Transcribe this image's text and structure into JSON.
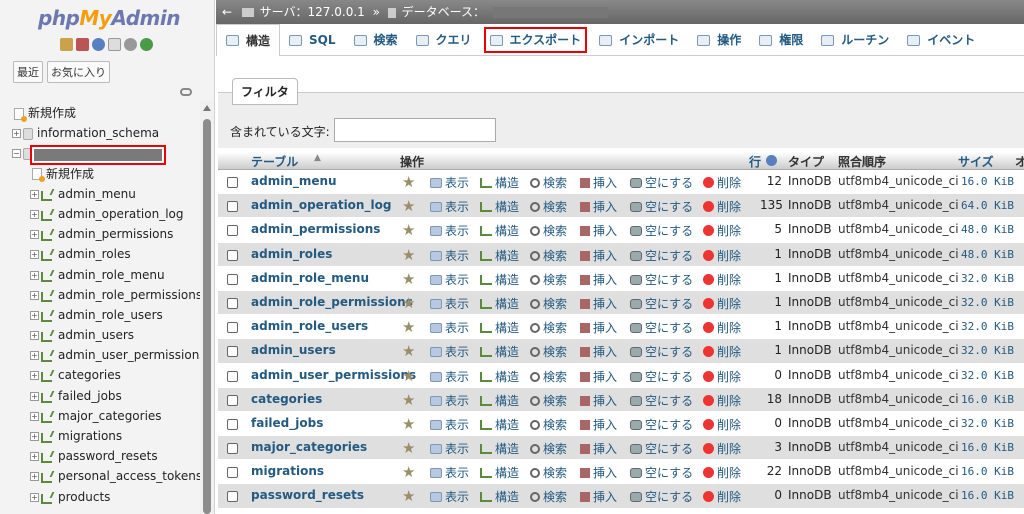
{
  "nav": {
    "logo": {
      "php": "php",
      "my": "My",
      "admin": "Admin"
    },
    "recent": "最近",
    "favorites": "お気に入り",
    "tree": [
      {
        "type": "new",
        "label": "新規作成",
        "level": 0
      },
      {
        "type": "db",
        "label": "information_schema",
        "level": 0
      },
      {
        "type": "db-selected",
        "label": "",
        "level": 0
      },
      {
        "type": "new",
        "label": "新規作成",
        "level": 1
      },
      {
        "type": "table",
        "label": "admin_menu",
        "level": 1
      },
      {
        "type": "table",
        "label": "admin_operation_log",
        "level": 1
      },
      {
        "type": "table",
        "label": "admin_permissions",
        "level": 1
      },
      {
        "type": "table",
        "label": "admin_roles",
        "level": 1
      },
      {
        "type": "table",
        "label": "admin_role_menu",
        "level": 1
      },
      {
        "type": "table",
        "label": "admin_role_permissions",
        "level": 1
      },
      {
        "type": "table",
        "label": "admin_role_users",
        "level": 1
      },
      {
        "type": "table",
        "label": "admin_users",
        "level": 1
      },
      {
        "type": "table",
        "label": "admin_user_permissions",
        "level": 1
      },
      {
        "type": "table",
        "label": "categories",
        "level": 1
      },
      {
        "type": "table",
        "label": "failed_jobs",
        "level": 1
      },
      {
        "type": "table",
        "label": "major_categories",
        "level": 1
      },
      {
        "type": "table",
        "label": "migrations",
        "level": 1
      },
      {
        "type": "table",
        "label": "password_resets",
        "level": 1
      },
      {
        "type": "table",
        "label": "personal_access_tokens",
        "level": 1
      },
      {
        "type": "table",
        "label": "products",
        "level": 1
      }
    ]
  },
  "breadcrumb": {
    "server": "サーバ：127.0.0.1",
    "sep": "»",
    "database": "データベース："
  },
  "tabs": [
    {
      "label": "構造",
      "icon": "structure-icon",
      "active": true
    },
    {
      "label": "SQL",
      "icon": "sql-icon"
    },
    {
      "label": "検索",
      "icon": "search-icon"
    },
    {
      "label": "クエリ",
      "icon": "query-icon"
    },
    {
      "label": "エクスポート",
      "icon": "export-icon",
      "highlight": true
    },
    {
      "label": "インポート",
      "icon": "import-icon"
    },
    {
      "label": "操作",
      "icon": "wrench-icon"
    },
    {
      "label": "権限",
      "icon": "privileges-icon"
    },
    {
      "label": "ルーチン",
      "icon": "routines-icon"
    },
    {
      "label": "イベント",
      "icon": "events-icon"
    }
  ],
  "filter": {
    "title": "フィルタ",
    "label": "含まれている文字:",
    "value": ""
  },
  "table_header": {
    "table": "テーブル",
    "action": "操作",
    "rows": "行",
    "type": "タイプ",
    "collation": "照合順序",
    "size": "サイズ",
    "overhead": "オ"
  },
  "actions": {
    "browse": "表示",
    "structure": "構造",
    "search": "検索",
    "insert": "挿入",
    "empty": "空にする",
    "drop": "削除"
  },
  "tables": [
    {
      "name": "admin_menu",
      "rows": "12",
      "engine": "InnoDB",
      "collation": "utf8mb4_unicode_ci",
      "size": "16.0 KiB"
    },
    {
      "name": "admin_operation_log",
      "rows": "135",
      "engine": "InnoDB",
      "collation": "utf8mb4_unicode_ci",
      "size": "64.0 KiB"
    },
    {
      "name": "admin_permissions",
      "rows": "5",
      "engine": "InnoDB",
      "collation": "utf8mb4_unicode_ci",
      "size": "48.0 KiB"
    },
    {
      "name": "admin_roles",
      "rows": "1",
      "engine": "InnoDB",
      "collation": "utf8mb4_unicode_ci",
      "size": "48.0 KiB"
    },
    {
      "name": "admin_role_menu",
      "rows": "1",
      "engine": "InnoDB",
      "collation": "utf8mb4_unicode_ci",
      "size": "32.0 KiB"
    },
    {
      "name": "admin_role_permissions",
      "rows": "1",
      "engine": "InnoDB",
      "collation": "utf8mb4_unicode_ci",
      "size": "32.0 KiB"
    },
    {
      "name": "admin_role_users",
      "rows": "1",
      "engine": "InnoDB",
      "collation": "utf8mb4_unicode_ci",
      "size": "32.0 KiB"
    },
    {
      "name": "admin_users",
      "rows": "1",
      "engine": "InnoDB",
      "collation": "utf8mb4_unicode_ci",
      "size": "32.0 KiB"
    },
    {
      "name": "admin_user_permissions",
      "rows": "0",
      "engine": "InnoDB",
      "collation": "utf8mb4_unicode_ci",
      "size": "32.0 KiB"
    },
    {
      "name": "categories",
      "rows": "18",
      "engine": "InnoDB",
      "collation": "utf8mb4_unicode_ci",
      "size": "16.0 KiB"
    },
    {
      "name": "failed_jobs",
      "rows": "0",
      "engine": "InnoDB",
      "collation": "utf8mb4_unicode_ci",
      "size": "32.0 KiB"
    },
    {
      "name": "major_categories",
      "rows": "3",
      "engine": "InnoDB",
      "collation": "utf8mb4_unicode_ci",
      "size": "16.0 KiB"
    },
    {
      "name": "migrations",
      "rows": "22",
      "engine": "InnoDB",
      "collation": "utf8mb4_unicode_ci",
      "size": "16.0 KiB"
    },
    {
      "name": "password_resets",
      "rows": "0",
      "engine": "InnoDB",
      "collation": "utf8mb4_unicode_ci",
      "size": "16.0 KiB"
    }
  ],
  "colors": {
    "link": "#235a81",
    "highlight": "#e00000",
    "logo_blue": "#6c78af",
    "logo_orange": "#f89c0e"
  }
}
